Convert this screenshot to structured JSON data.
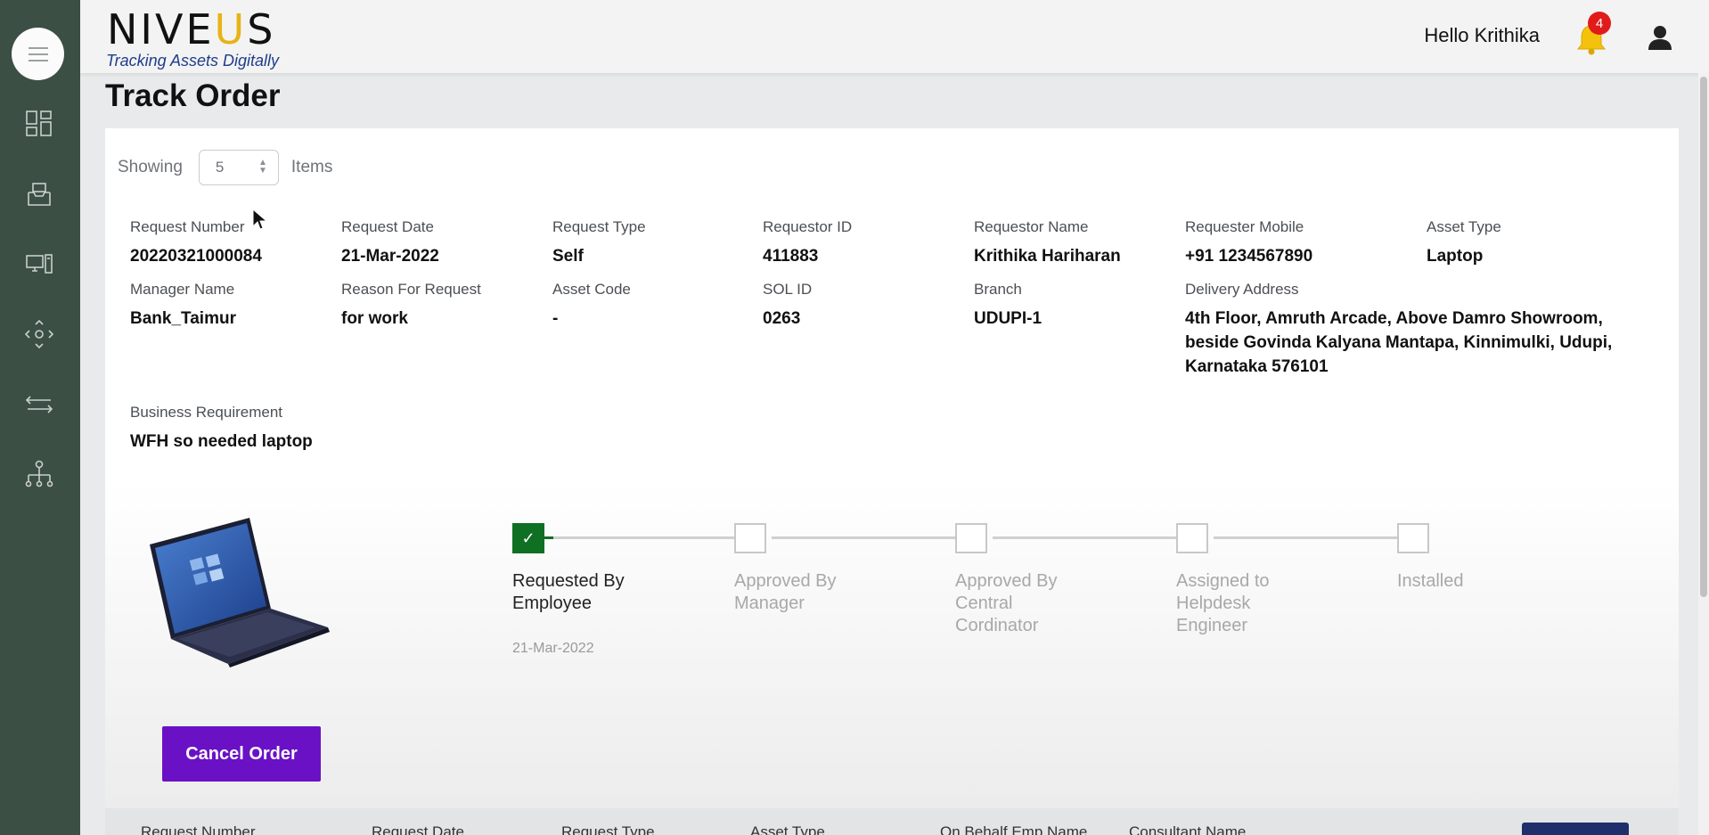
{
  "header": {
    "logo_pre": "NIVE",
    "logo_u": "U",
    "logo_post": "S",
    "tagline": "Tracking Assets Digitally",
    "greeting": "Hello Krithika",
    "notification_count": "4"
  },
  "sidebar": {
    "items": [
      {
        "icon": "menu-icon"
      },
      {
        "icon": "dashboard-icon"
      },
      {
        "icon": "inbox-icon"
      },
      {
        "icon": "devices-icon"
      },
      {
        "icon": "move-icon"
      },
      {
        "icon": "transfer-icon"
      },
      {
        "icon": "hierarchy-icon"
      }
    ]
  },
  "page": {
    "title": "Track Order",
    "showing_label": "Showing",
    "items_per_page": "5",
    "items_label": "Items"
  },
  "order": {
    "request_number": {
      "label": "Request Number",
      "value": "20220321000084"
    },
    "request_date": {
      "label": "Request Date",
      "value": "21-Mar-2022"
    },
    "request_type": {
      "label": "Request Type",
      "value": "Self"
    },
    "requestor_id": {
      "label": "Requestor ID",
      "value": "411883"
    },
    "requestor_name": {
      "label": "Requestor Name",
      "value": "Krithika Hariharan"
    },
    "requester_mobile": {
      "label": "Requester Mobile",
      "value": "+91 1234567890"
    },
    "asset_type": {
      "label": "Asset Type",
      "value": "Laptop"
    },
    "manager_name": {
      "label": "Manager Name",
      "value": "Bank_Taimur"
    },
    "reason": {
      "label": "Reason For Request",
      "value": "for work"
    },
    "asset_code": {
      "label": "Asset Code",
      "value": "-"
    },
    "sol_id": {
      "label": "SOL ID",
      "value": "0263"
    },
    "branch": {
      "label": "Branch",
      "value": "UDUPI-1"
    },
    "delivery_address": {
      "label": "Delivery Address",
      "value": "4th Floor, Amruth Arcade, Above Damro Showroom, beside Govinda Kalyana Mantapa, Kinnimulki, Udupi, Karnataka 576101"
    },
    "business_requirement": {
      "label": "Business Requirement",
      "value": "WFH so needed laptop"
    }
  },
  "tracker": {
    "steps": [
      {
        "label": "Requested By Employee",
        "status": "done",
        "date": "21-Mar-2022"
      },
      {
        "label": "Approved By Manager",
        "status": "pending"
      },
      {
        "label": "Approved By Central Cordinator",
        "status": "pending"
      },
      {
        "label": "Assigned to Helpdesk Engineer",
        "status": "pending"
      },
      {
        "label": "Installed",
        "status": "pending"
      }
    ]
  },
  "actions": {
    "cancel_label": "Cancel Order"
  },
  "table": {
    "columns": [
      "Request Number",
      "Request Date",
      "Request Type",
      "Asset Type",
      "On Behalf Emp Name",
      "Consultant Name"
    ]
  },
  "colors": {
    "sidebar": "#3c4f44",
    "accent": "#6a11c6",
    "step_done": "#0f6f22",
    "badge": "#e11b1b",
    "tagline": "#1f3d8a",
    "logo_u": "#e7b316"
  }
}
